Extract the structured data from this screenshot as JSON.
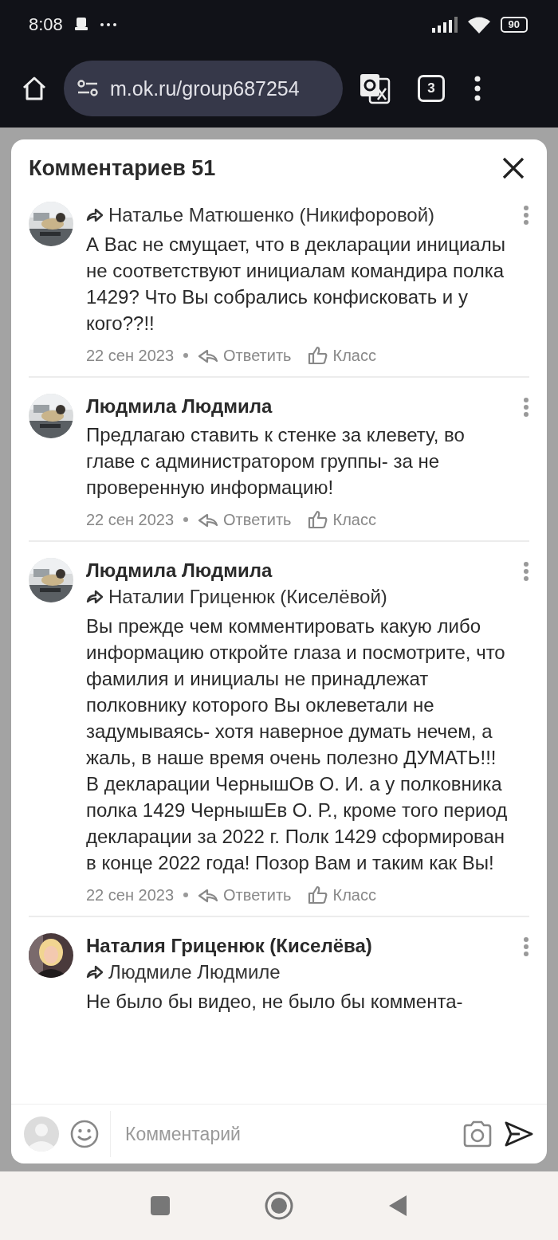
{
  "status_bar": {
    "time": "8:08",
    "battery": "90"
  },
  "browser": {
    "url": "m.ok.ru/group687254",
    "tab_count": "3"
  },
  "sheet": {
    "title": "Комментариев 51",
    "comments": [
      {
        "reply_to": "Наталье Матюшенко (Никифоровой)",
        "text": "А Вас не смущает, что в декларации инициалы не соответствуют инициалам командира полка 1429? Что Вы собрались конфисковать и у кого??!!",
        "date": "22 сен 2023",
        "reply_label": "Ответить",
        "like_label": "Класс"
      },
      {
        "author": "Людмила Людмила",
        "text": "Предлагаю ставить к стенке за клевету, во главе с администратором группы- за не проверенную информацию!",
        "date": "22 сен 2023",
        "reply_label": "Ответить",
        "like_label": "Класс"
      },
      {
        "author": "Людмила Людмила",
        "reply_to": "Наталии Гриценюк (Киселёвой)",
        "text": "Вы прежде чем комментировать какую либо информацию откройте глаза и посмотрите, что фамилия и инициалы не принадлежат полковнику которого Вы оклеветали не задумываясь- хотя наверное думать нечем, а жаль, в наше время очень полезно ДУМАТЬ!!! В декларации ЧернышОв О. И. а у полковника полка 1429 ЧернышЕв О. Р., кроме того период декларации за 2022 г. Полк 1429 сформирован в конце 2022 года! Позор Вам и таким как Вы!",
        "date": "22 сен 2023",
        "reply_label": "Ответить",
        "like_label": "Класс"
      },
      {
        "author": "Наталия Гриценюк (Киселёва)",
        "reply_to": "Людмиле Людмиле",
        "text": "Не было бы видео, не было бы коммента-"
      }
    ],
    "composer": {
      "placeholder": "Комментарий"
    }
  }
}
